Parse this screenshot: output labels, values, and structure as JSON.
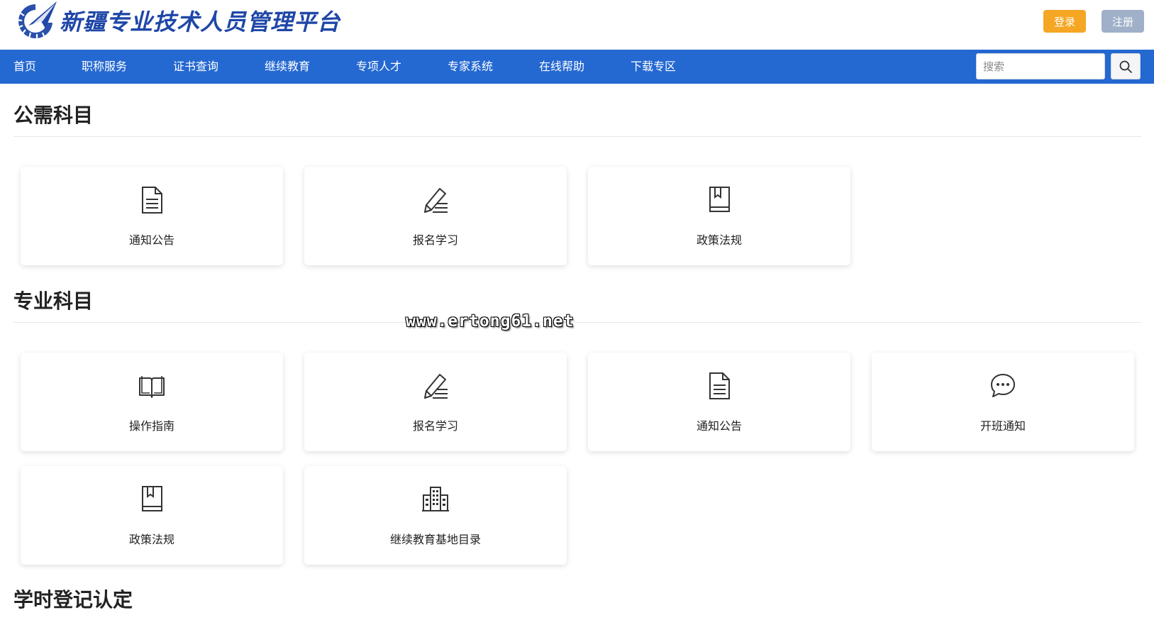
{
  "header": {
    "site_title": "新疆专业技术人员管理平台",
    "login_label": "登录",
    "register_label": "注册",
    "login_color": "#f5a623",
    "register_color": "#9fb0c8"
  },
  "nav": {
    "items": [
      {
        "label": "首页"
      },
      {
        "label": "职称服务"
      },
      {
        "label": "证书查询"
      },
      {
        "label": "继续教育"
      },
      {
        "label": "专项人才"
      },
      {
        "label": "专家系统"
      },
      {
        "label": "在线帮助"
      },
      {
        "label": "下载专区"
      }
    ],
    "search_placeholder": "搜索",
    "bar_color": "#2468d1"
  },
  "sections": {
    "public": {
      "title": "公需科目",
      "cards": [
        {
          "label": "通知公告",
          "icon": "document-icon"
        },
        {
          "label": "报名学习",
          "icon": "pen-icon"
        },
        {
          "label": "政策法规",
          "icon": "book-icon"
        }
      ]
    },
    "professional": {
      "title": "专业科目",
      "cards": [
        {
          "label": "操作指南",
          "icon": "open-book-icon"
        },
        {
          "label": "报名学习",
          "icon": "pen-icon"
        },
        {
          "label": "通知公告",
          "icon": "document-icon"
        },
        {
          "label": "开班通知",
          "icon": "chat-icon"
        },
        {
          "label": "政策法规",
          "icon": "book-icon"
        },
        {
          "label": "继续教育基地目录",
          "icon": "building-icon"
        }
      ]
    },
    "hours": {
      "title": "学时登记认定"
    }
  },
  "watermark": "www.ertong61.net"
}
